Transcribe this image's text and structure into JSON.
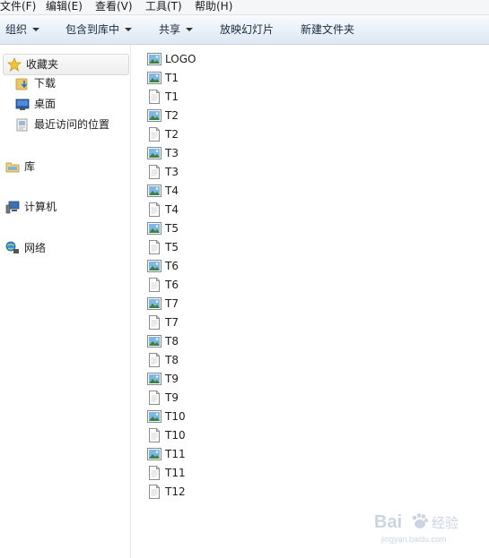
{
  "menu": [
    "文件(F)",
    "编辑(E)",
    "查看(V)",
    "工具(T)",
    "帮助(H)"
  ],
  "toolbar": {
    "organize": "组织",
    "include_library": "包含到库中",
    "share": "共享",
    "slideshow": "放映幻灯片",
    "new_folder": "新建文件夹"
  },
  "nav": {
    "favorites": "收藏夹",
    "downloads": "下载",
    "desktop": "桌面",
    "recent": "最近访问的位置",
    "libraries": "库",
    "computer": "计算机",
    "network": "网络"
  },
  "files": [
    {
      "name": "LOGO",
      "type": "image"
    },
    {
      "name": "T1",
      "type": "image"
    },
    {
      "name": "T1",
      "type": "text"
    },
    {
      "name": "T2",
      "type": "image"
    },
    {
      "name": "T2",
      "type": "text"
    },
    {
      "name": "T3",
      "type": "image"
    },
    {
      "name": "T3",
      "type": "text"
    },
    {
      "name": "T4",
      "type": "image"
    },
    {
      "name": "T4",
      "type": "text"
    },
    {
      "name": "T5",
      "type": "image"
    },
    {
      "name": "T5",
      "type": "text"
    },
    {
      "name": "T6",
      "type": "image"
    },
    {
      "name": "T6",
      "type": "text"
    },
    {
      "name": "T7",
      "type": "image"
    },
    {
      "name": "T7",
      "type": "text"
    },
    {
      "name": "T8",
      "type": "image"
    },
    {
      "name": "T8",
      "type": "text"
    },
    {
      "name": "T9",
      "type": "image"
    },
    {
      "name": "T9",
      "type": "text"
    },
    {
      "name": "T10",
      "type": "image"
    },
    {
      "name": "T10",
      "type": "text"
    },
    {
      "name": "T11",
      "type": "image"
    },
    {
      "name": "T11",
      "type": "text"
    },
    {
      "name": "T12",
      "type": "text"
    }
  ],
  "watermark": {
    "brand": "Bai",
    "brand2": "经验",
    "url": "jingyan.baidu.com"
  },
  "colors": {
    "accent": "#1e73be",
    "toolbar_top": "#f8fbfe",
    "toolbar_bottom": "#dfe8f2"
  }
}
